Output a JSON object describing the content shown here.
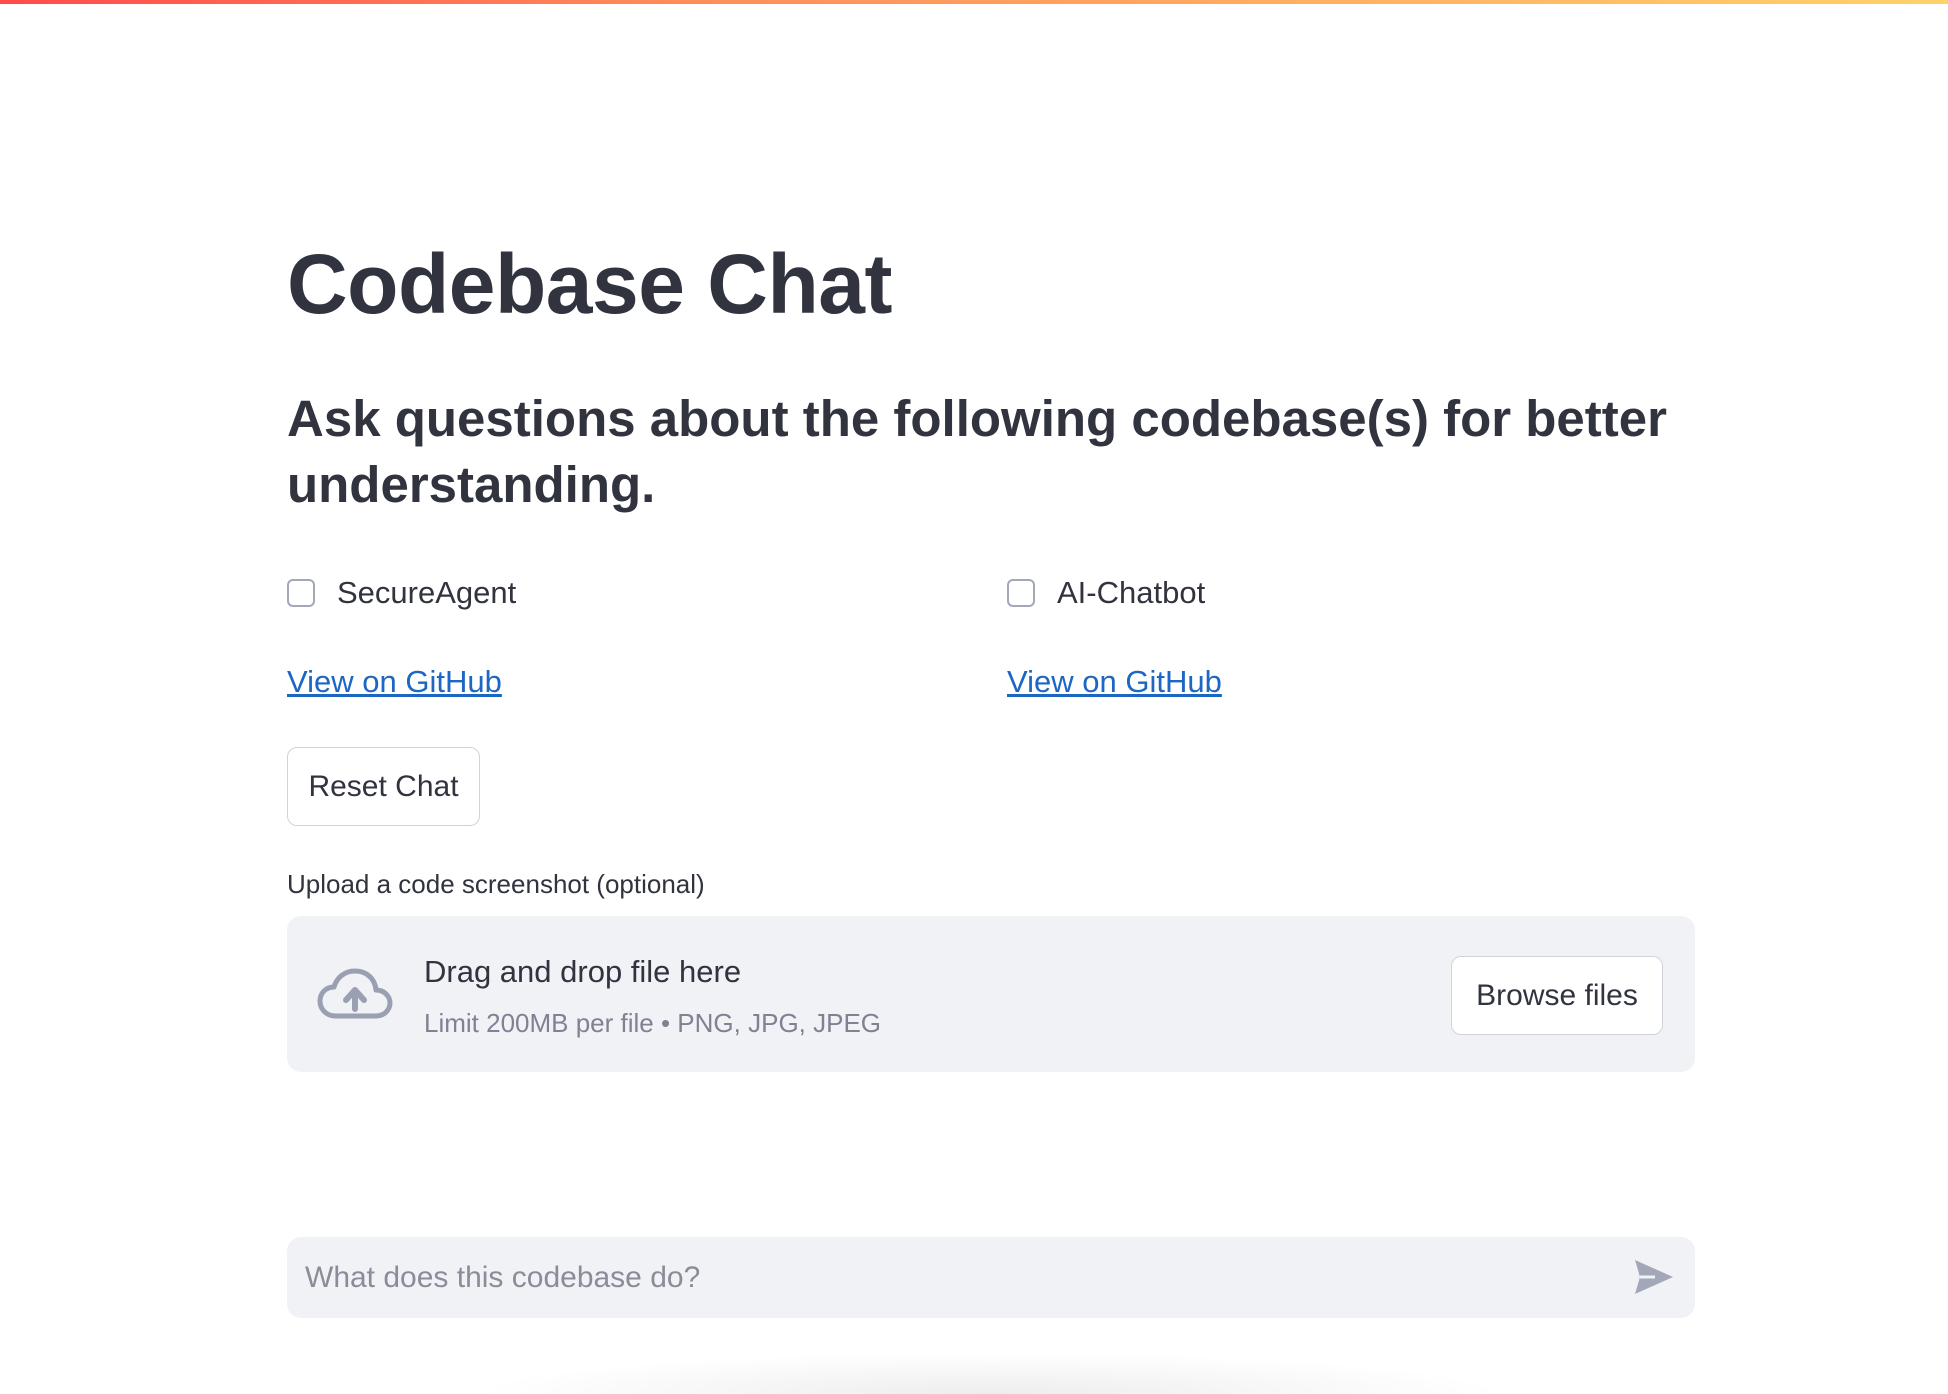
{
  "app": {
    "title": "Codebase Chat",
    "subtitle": "Ask questions about the following codebase(s) for better understanding."
  },
  "repos": [
    {
      "name": "SecureAgent",
      "checked": false,
      "link_label": "View on GitHub"
    },
    {
      "name": "AI-Chatbot",
      "checked": false,
      "link_label": "View on GitHub"
    }
  ],
  "buttons": {
    "reset_label": "Reset Chat"
  },
  "uploader": {
    "label": "Upload a code screenshot (optional)",
    "dropzone_title": "Drag and drop file here",
    "limit_text": "Limit 200MB per file • PNG, JPG, JPEG",
    "browse_label": "Browse files",
    "icon": "cloud-upload-icon"
  },
  "chat": {
    "placeholder": "What does this codebase do?",
    "value": "",
    "send_icon": "send-icon"
  },
  "colors": {
    "accent_gradient": [
      "#ff4b4b",
      "#ffd16a"
    ],
    "link": "#1c66c4",
    "text": "#31333f",
    "panel_bg": "#f0f2f6"
  }
}
